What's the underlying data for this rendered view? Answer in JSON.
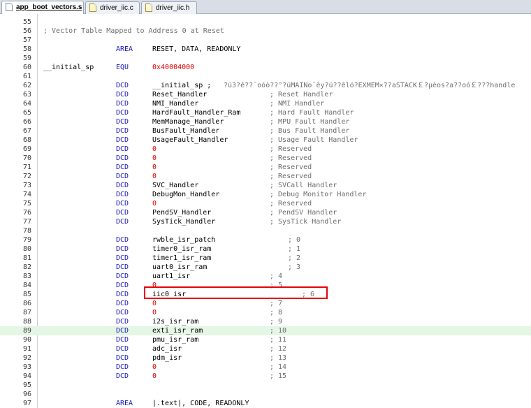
{
  "tabs": [
    {
      "label": "app_boot_vectors.s",
      "active": true,
      "icon": "asm-file-icon"
    },
    {
      "label": "driver_iic.c",
      "active": false,
      "icon": "c-file-icon"
    },
    {
      "label": "driver_iic.h",
      "active": false,
      "icon": "h-file-icon"
    }
  ],
  "colors": {
    "keyword": "#1a1ab8",
    "number": "#e00000",
    "comment": "#6e6e6e",
    "current_line": "#e4f6e4",
    "highlight_box": "#e8000b"
  },
  "highlight_line": 89,
  "annotated_line": 85,
  "lines": [
    {
      "n": "55"
    },
    {
      "n": "56",
      "comment": "; Vector Table Mapped to Address 0 at Reset"
    },
    {
      "n": "57"
    },
    {
      "n": "58",
      "op": "AREA",
      "arg": "RESET, DATA, READONLY"
    },
    {
      "n": "59"
    },
    {
      "n": "60",
      "label": "__initial_sp",
      "op": "EQU",
      "num": "0x40004000"
    },
    {
      "n": "61"
    },
    {
      "n": "62",
      "op": "DCD",
      "arg": "__initial_sp ;",
      "comment": "?ú3?ê??¯oóò??°?úMAINo¯êy?ú??êló?EXMEM×??aSTACK￡?µèos?a??oó￡???handle"
    },
    {
      "n": "63",
      "op": "DCD",
      "arg": "Reset_Handler",
      "comment": "; Reset Handler"
    },
    {
      "n": "64",
      "op": "DCD",
      "arg": "NMI_Handler",
      "comment": "; NMI Handler"
    },
    {
      "n": "65",
      "op": "DCD",
      "arg": "HardFault_Handler_Ram",
      "comment": "; Hard Fault Handler"
    },
    {
      "n": "66",
      "op": "DCD",
      "arg": "MemManage_Handler",
      "comment": "; MPU Fault Handler"
    },
    {
      "n": "67",
      "op": "DCD",
      "arg": "BusFault_Handler",
      "comment": "; Bus Fault Handler"
    },
    {
      "n": "68",
      "op": "DCD",
      "arg": "UsageFault_Handler",
      "comment": "; Usage Fault Handler"
    },
    {
      "n": "69",
      "op": "DCD",
      "num": "0",
      "comment": "; Reserved"
    },
    {
      "n": "70",
      "op": "DCD",
      "num": "0",
      "comment": "; Reserved"
    },
    {
      "n": "71",
      "op": "DCD",
      "num": "0",
      "comment": "; Reserved"
    },
    {
      "n": "72",
      "op": "DCD",
      "num": "0",
      "comment": "; Reserved"
    },
    {
      "n": "73",
      "op": "DCD",
      "arg": "SVC_Handler",
      "comment": "; SVCall Handler"
    },
    {
      "n": "74",
      "op": "DCD",
      "arg": "DebugMon_Handler",
      "comment": "; Debug Monitor Handler"
    },
    {
      "n": "75",
      "op": "DCD",
      "num": "0",
      "comment": "; Reserved"
    },
    {
      "n": "76",
      "op": "DCD",
      "arg": "PendSV_Handler",
      "comment": "; PendSV Handler"
    },
    {
      "n": "77",
      "op": "DCD",
      "arg": "SysTick_Handler",
      "comment": "; SysTick Handler"
    },
    {
      "n": "78"
    },
    {
      "n": "79",
      "op": "DCD",
      "arg": "rwble_isr_patch",
      "comment": "; 0"
    },
    {
      "n": "80",
      "op": "DCD",
      "arg": "timer0_isr_ram",
      "comment": "; 1"
    },
    {
      "n": "81",
      "op": "DCD",
      "arg": "timer1_isr_ram",
      "comment": "; 2"
    },
    {
      "n": "82",
      "op": "DCD",
      "arg": "uart0_isr_ram",
      "comment": "; 3"
    },
    {
      "n": "83",
      "op": "DCD",
      "arg": "uart1_isr",
      "comment": "; 4"
    },
    {
      "n": "84",
      "op": "DCD",
      "num": "0",
      "comment": "; 5"
    },
    {
      "n": "85",
      "op": "DCD",
      "arg": "iic0_isr",
      "comment": "; 6"
    },
    {
      "n": "86",
      "op": "DCD",
      "num": "0",
      "comment": "; 7"
    },
    {
      "n": "87",
      "op": "DCD",
      "num": "0",
      "comment": "; 8"
    },
    {
      "n": "88",
      "op": "DCD",
      "arg": "i2s_isr_ram",
      "comment": "; 9"
    },
    {
      "n": "89",
      "op": "DCD",
      "arg": "exti_isr_ram",
      "comment": "; 10"
    },
    {
      "n": "90",
      "op": "DCD",
      "arg": "pmu_isr_ram",
      "comment": "; 11"
    },
    {
      "n": "91",
      "op": "DCD",
      "arg": "adc_isr",
      "comment": "; 12"
    },
    {
      "n": "92",
      "op": "DCD",
      "arg": "pdm_isr",
      "comment": "; 13"
    },
    {
      "n": "93",
      "op": "DCD",
      "num": "0",
      "comment": "; 14"
    },
    {
      "n": "94",
      "op": "DCD",
      "num": "0",
      "comment": "; 15"
    },
    {
      "n": "95"
    },
    {
      "n": "96"
    },
    {
      "n": "97",
      "op": "AREA",
      "arg": "|.text|, CODE, READONLY"
    }
  ]
}
